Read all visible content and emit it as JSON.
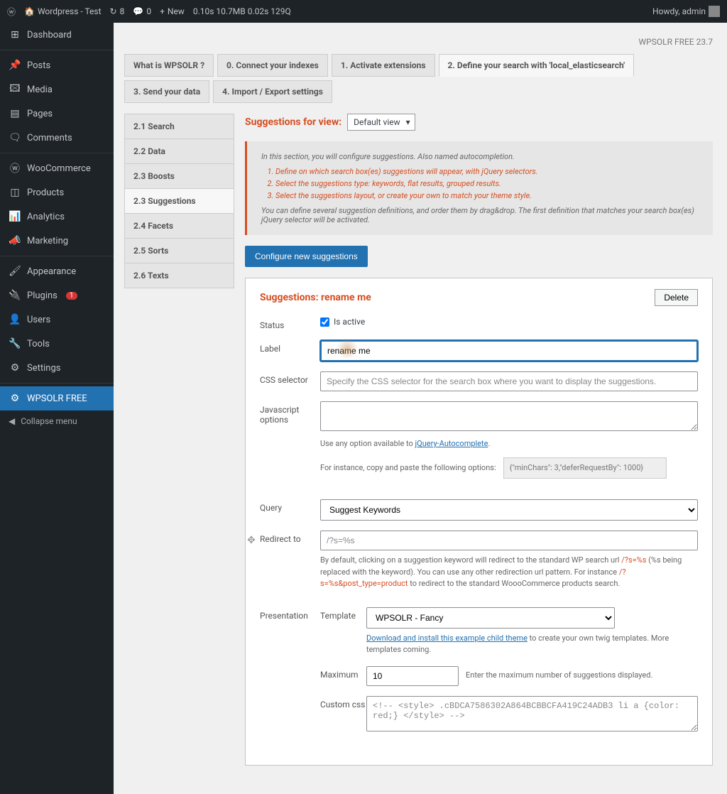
{
  "topbar": {
    "site_name": "Wordpress - Test",
    "refresh_count": "8",
    "comments_count": "0",
    "new_label": "New",
    "stats": "0.10s  10.7MB  0.02s  129Q",
    "howdy": "Howdy, admin"
  },
  "sidebar": {
    "items": [
      {
        "icon": "🏠",
        "label": "Dashboard"
      },
      {
        "icon": "📌",
        "label": "Posts"
      },
      {
        "icon": "🖼",
        "label": "Media"
      },
      {
        "icon": "📄",
        "label": "Pages"
      },
      {
        "icon": "💬",
        "label": "Comments"
      },
      {
        "icon": "🛒",
        "label": "WooCommerce"
      },
      {
        "icon": "📦",
        "label": "Products"
      },
      {
        "icon": "📊",
        "label": "Analytics"
      },
      {
        "icon": "📣",
        "label": "Marketing"
      },
      {
        "icon": "🎨",
        "label": "Appearance"
      },
      {
        "icon": "🔌",
        "label": "Plugins",
        "badge": "1"
      },
      {
        "icon": "👤",
        "label": "Users"
      },
      {
        "icon": "🔧",
        "label": "Tools"
      },
      {
        "icon": "⚙",
        "label": "Settings"
      },
      {
        "icon": "⚙",
        "label": "WPSOLR FREE"
      }
    ],
    "collapse": "Collapse menu"
  },
  "version": "WPSOLR FREE 23.7",
  "tabs": [
    {
      "label": "What is WPSOLR ?"
    },
    {
      "label": "0. Connect your indexes"
    },
    {
      "label": "1. Activate extensions"
    },
    {
      "label": "2. Define your search with 'local_elasticsearch'"
    },
    {
      "label": "3. Send your data"
    },
    {
      "label": "4. Import / Export settings"
    }
  ],
  "subnav": [
    {
      "label": "2.1 Search"
    },
    {
      "label": "2.2 Data"
    },
    {
      "label": "2.3 Boosts"
    },
    {
      "label": "2.3 Suggestions"
    },
    {
      "label": "2.4 Facets"
    },
    {
      "label": "2.5 Sorts"
    },
    {
      "label": "2.6 Texts"
    }
  ],
  "view": {
    "label": "Suggestions for view:",
    "selected": "Default view"
  },
  "info": {
    "intro": "In this section, you will configure suggestions. Also named autocompletion.",
    "li1": "Define on which search box(es) suggestions will appear, with jQuery selectors.",
    "li2": "Select the suggestions type: keywords, flat results, grouped results.",
    "li3": "Select the suggestions layout, or create your own to match your theme style.",
    "outro": "You can define several suggestion definitions, and order them by drag&drop. The first definition that matches your search box(es) jQuery selector will be activated."
  },
  "configure_btn": "Configure new suggestions",
  "card": {
    "title": "Suggestions: rename me",
    "delete": "Delete",
    "labels": {
      "status": "Status",
      "is_active": "Is active",
      "label": "Label",
      "css_selector": "CSS selector",
      "js_options": "Javascript options",
      "query": "Query",
      "redirect_to": "Redirect to",
      "presentation": "Presentation",
      "template": "Template",
      "maximum": "Maximum",
      "custom_css": "Custom css"
    },
    "values": {
      "label_value": "rename me",
      "css_placeholder": "Specify the CSS selector for the search box where you want to display the suggestions.",
      "js_help_prefix": "Use any option available to ",
      "js_help_link": "jQuery-Autocomplete",
      "js_help_eg": "For instance, copy and paste the following options:",
      "js_eg_value": "{\"minChars\": 3,\"deferRequestBy\": 1000}",
      "query_value": "Suggest Keywords",
      "redirect_value": "/?s=%s",
      "redirect_help_1": "By default, clicking on a suggestion keyword will redirect to the standard WP search url ",
      "redirect_help_link1": "/?s=%s",
      "redirect_help_2": " (%s being replaced with the keyword). You can use any other redirection url pattern. For instance ",
      "redirect_help_link2": "/?s=%s&post_type=product",
      "redirect_help_3": " to redirect to the standard WoooCommerce products search.",
      "template_value": "WPSOLR - Fancy",
      "template_link": "Download and install this example child theme",
      "template_help": " to create your own twig templates. More templates coming.",
      "maximum_value": "10",
      "maximum_help": "Enter the maximum number of suggestions displayed.",
      "custom_css_value": "<!-- <style> .cBDCA7586302A864BCBBCFA419C24ADB3 li a {color: red;} </style> -->"
    }
  }
}
